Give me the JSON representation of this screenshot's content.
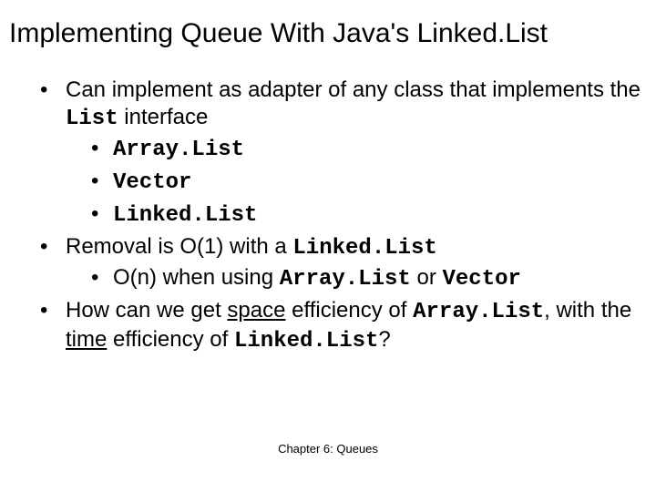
{
  "title": "Implementing Queue With Java's Linked.List",
  "bullets": {
    "b1_pre": "Can implement as adapter of any class that implements the ",
    "b1_code": "List",
    "b1_post": " interface",
    "b1a": "Array.List",
    "b1b": "Vector",
    "b1c": "Linked.List",
    "b2_pre": "Removal is O(1) with a ",
    "b2_code": "Linked.List",
    "b2a_pre": "O(n)  when using ",
    "b2a_code1": "Array.List",
    "b2a_mid": " or ",
    "b2a_code2": "Vector",
    "b3_pre": "How can we get ",
    "b3_u1": "space",
    "b3_mid1": " efficiency of ",
    "b3_code1": "Array.List",
    "b3_mid2": ", with the ",
    "b3_u2": "time",
    "b3_mid3": " efficiency of ",
    "b3_code2": "Linked.List",
    "b3_post": "?"
  },
  "footer": "Chapter 6: Queues"
}
